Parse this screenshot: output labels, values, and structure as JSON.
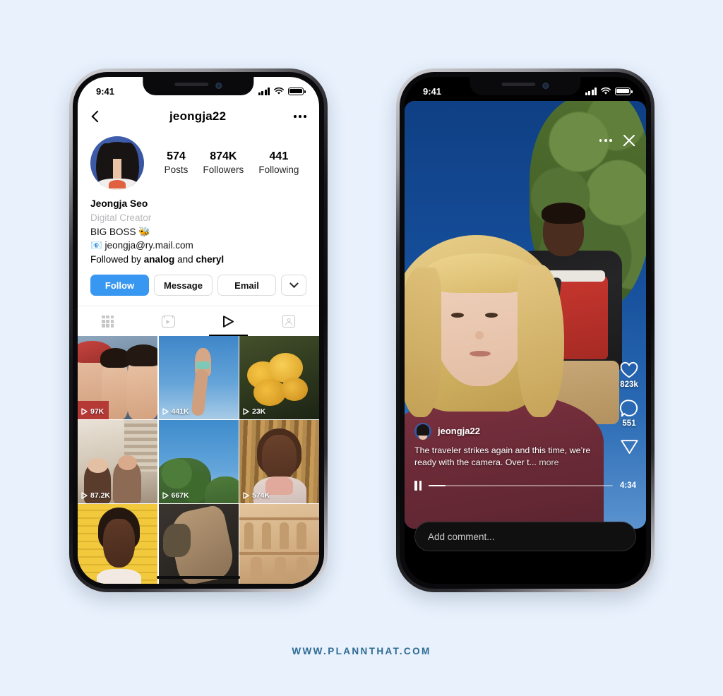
{
  "page": {
    "background_color": "#e8f1fc",
    "watermark": "WWW.PLANNTHAT.COM",
    "watermark_color": "#2d6a93"
  },
  "left_phone": {
    "status_bar": {
      "time": "9:41"
    },
    "header": {
      "back_icon": "chevron-left-icon",
      "title": "jeongja22",
      "more_icon": "more-horizontal-icon"
    },
    "profile": {
      "avatar_name": "profile-avatar",
      "stats": [
        {
          "num": "574",
          "label": "Posts"
        },
        {
          "num": "874K",
          "label": "Followers"
        },
        {
          "num": "441",
          "label": "Following"
        }
      ],
      "full_name": "Jeongja Seo",
      "category": "Digital Creator",
      "bio_line": "BIG BOSS 🐝",
      "contact": "📧 jeongja@ry.mail.com",
      "followed_by_prefix": "Followed by ",
      "followed_by_a": "analog",
      "followed_by_mid": " and ",
      "followed_by_b": "cheryl"
    },
    "actions": {
      "follow": "Follow",
      "message": "Message",
      "email": "Email",
      "caret_icon": "chevron-down-icon",
      "follow_color": "#3897f0"
    },
    "tabs": [
      {
        "icon": "grid-icon",
        "active": false
      },
      {
        "icon": "reels-icon",
        "active": false
      },
      {
        "icon": "igtv-play-icon",
        "active": true
      },
      {
        "icon": "tagged-icon",
        "active": false
      }
    ],
    "thumbnails": [
      {
        "views": "97K",
        "alt": "three-friends-selfie"
      },
      {
        "views": "441K",
        "alt": "hand-reaching-sky"
      },
      {
        "views": "23K",
        "alt": "yellow-mushrooms"
      },
      {
        "views": "87.2K",
        "alt": "couple-indoors"
      },
      {
        "views": "667K",
        "alt": "tree-against-sky"
      },
      {
        "views": "574K",
        "alt": "woman-portrait-curtain"
      },
      {
        "views": "",
        "alt": "woman-yellow-brick-wall"
      },
      {
        "views": "",
        "alt": "desert-rock-texture"
      },
      {
        "views": "",
        "alt": "carved-stone-relief"
      }
    ],
    "bottom_nav": [
      {
        "icon": "home-icon"
      },
      {
        "icon": "search-icon"
      },
      {
        "icon": "reels-icon"
      },
      {
        "icon": "shop-icon"
      },
      {
        "icon": "profile-icon"
      }
    ]
  },
  "right_phone": {
    "status_bar": {
      "time": "9:41"
    },
    "video_overlay": {
      "more_icon": "more-horizontal-icon",
      "close_icon": "close-icon",
      "username": "jeongja22",
      "avatar_name": "video-author-avatar",
      "caption": "The traveler strikes again and this time, we’re ready with the camera. Over t...",
      "caption_more": "more",
      "like_icon": "heart-icon",
      "like_count": "823k",
      "comment_icon": "comment-bubble-icon",
      "comment_count": "551",
      "share_icon": "paper-plane-icon",
      "pause_icon": "pause-icon",
      "progress_percent": 9,
      "duration": "4:34"
    },
    "comment_input": {
      "placeholder": "Add comment..."
    }
  }
}
